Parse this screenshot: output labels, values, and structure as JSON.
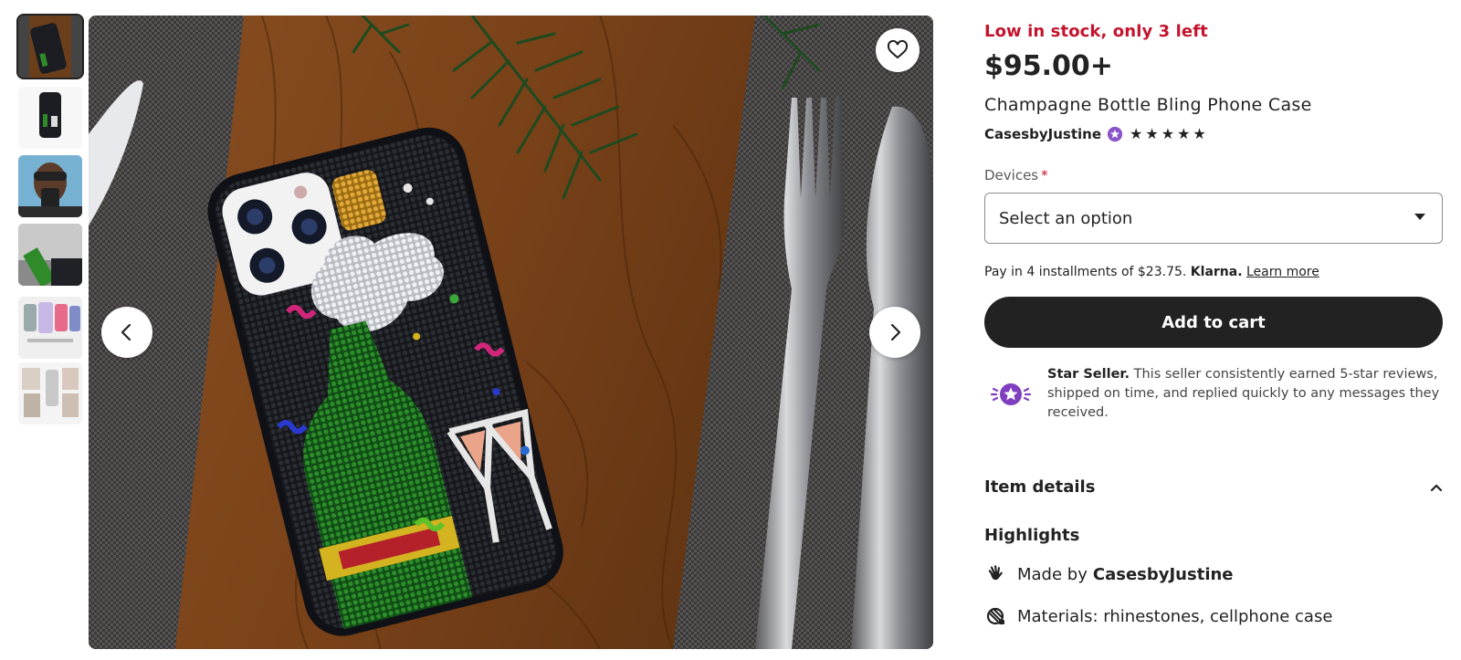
{
  "gallery": {
    "thumbnails": [
      {
        "alt": "phone case on table"
      },
      {
        "alt": "phone case on white"
      },
      {
        "alt": "woman holding phone"
      },
      {
        "alt": "close-up of rhinestones"
      },
      {
        "alt": "multiple case views"
      },
      {
        "alt": "case details"
      }
    ],
    "favorite_icon": "heart-outline-icon",
    "prev_icon": "chevron-left-icon",
    "next_icon": "chevron-right-icon"
  },
  "product": {
    "stock_notice": "Low in stock, only 3 left",
    "price": "$95.00+",
    "title": "Champagne Bottle Bling Phone Case",
    "seller": "CasesbyJustine",
    "rating": 5,
    "stars": [
      "★",
      "★",
      "★",
      "★",
      "★"
    ]
  },
  "options": {
    "devices_label": "Devices",
    "required_mark": "*",
    "select_value": "Select an option"
  },
  "payment": {
    "prefix": "Pay in 4 installments of $23.75.",
    "provider": "Klarna.",
    "learn_more": "Learn more"
  },
  "cart": {
    "button_label": "Add to cart"
  },
  "star_seller": {
    "title": "Star Seller.",
    "text": "This seller consistently earned 5-star reviews, shipped on time, and replied quickly to any messages they received."
  },
  "details": {
    "section_title": "Item details",
    "highlights_title": "Highlights",
    "made_by_label": "Made by",
    "made_by_value": "CasesbyJustine",
    "materials": "Materials: rhinestones, cellphone case"
  },
  "colors": {
    "accent_red": "#c4142d",
    "button_dark": "#222222",
    "star_seller_purple": "#7f3fbf"
  }
}
